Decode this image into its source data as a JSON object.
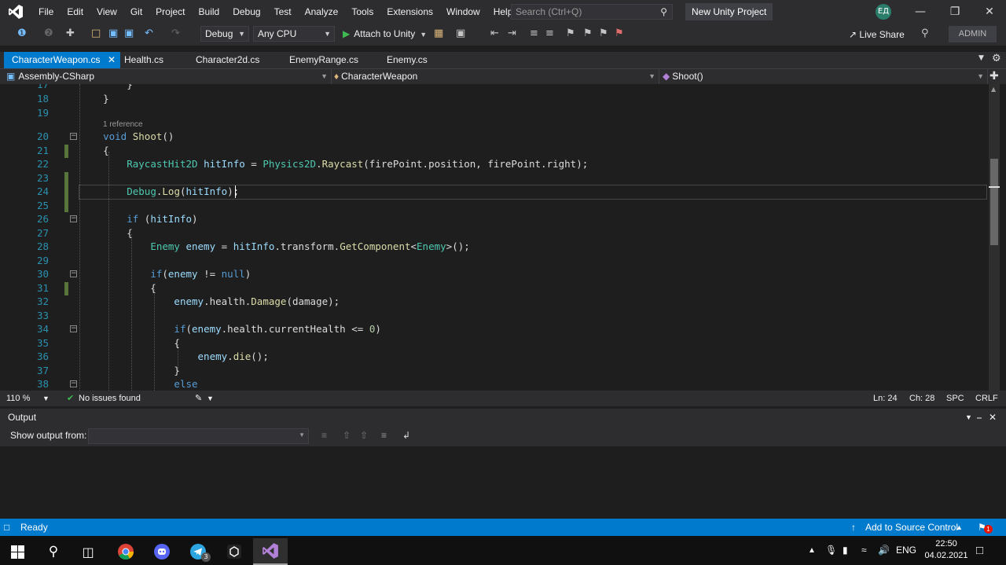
{
  "menubar": {
    "items": [
      "File",
      "Edit",
      "View",
      "Git",
      "Project",
      "Build",
      "Debug",
      "Test",
      "Analyze",
      "Tools",
      "Extensions",
      "Window",
      "Help"
    ],
    "search_placeholder": "Search (Ctrl+Q)",
    "project_name": "New Unity Project",
    "avatar_initials": "ЕД"
  },
  "toolbar": {
    "config": "Debug",
    "platform": "Any CPU",
    "attach_label": "Attach to Unity",
    "live_share": "Live Share",
    "admin_label": "ADMIN"
  },
  "tabs": [
    {
      "label": "CharacterWeapon.cs",
      "active": true
    },
    {
      "label": "Health.cs"
    },
    {
      "label": "Character2d.cs"
    },
    {
      "label": "EnemyRange.cs"
    },
    {
      "label": "Enemy.cs"
    }
  ],
  "navbar": {
    "project": "Assembly-CSharp",
    "class": "CharacterWeapon",
    "member": "Shoot()"
  },
  "editor": {
    "reference_hint": "1 reference",
    "lines": [
      {
        "n": "17",
        "text": "        }"
      },
      {
        "n": "18",
        "text": "    }"
      },
      {
        "n": "19",
        "text": ""
      },
      {
        "n": "20",
        "text": "    void Shoot()"
      },
      {
        "n": "21",
        "text": "    {"
      },
      {
        "n": "22",
        "text": "        RaycastHit2D hitInfo = Physics2D.Raycast(firePoint.position, firePoint.right);"
      },
      {
        "n": "23",
        "text": ""
      },
      {
        "n": "24",
        "text": "        Debug.Log(hitInfo);"
      },
      {
        "n": "25",
        "text": ""
      },
      {
        "n": "26",
        "text": "        if (hitInfo)"
      },
      {
        "n": "27",
        "text": "        {"
      },
      {
        "n": "28",
        "text": "            Enemy enemy = hitInfo.transform.GetComponent<Enemy>();"
      },
      {
        "n": "29",
        "text": ""
      },
      {
        "n": "30",
        "text": "            if(enemy != null)"
      },
      {
        "n": "31",
        "text": "            {"
      },
      {
        "n": "32",
        "text": "                enemy.health.Damage(damage);"
      },
      {
        "n": "33",
        "text": ""
      },
      {
        "n": "34",
        "text": "                if(enemy.health.currentHealth <= 0)"
      },
      {
        "n": "35",
        "text": "                {"
      },
      {
        "n": "36",
        "text": "                    enemy.die();"
      },
      {
        "n": "37",
        "text": "                }"
      },
      {
        "n": "38",
        "text": "                else"
      }
    ]
  },
  "editor_status": {
    "zoom": "110 %",
    "issues": "No issues found",
    "line": "Ln: 24",
    "col": "Ch: 28",
    "spc": "SPC",
    "crlf": "CRLF"
  },
  "output": {
    "title": "Output",
    "show_from_label": "Show output from:"
  },
  "statusbar": {
    "ready": "Ready",
    "source_control": "Add to Source Control",
    "notif_count": "1"
  },
  "taskbar": {
    "lang": "ENG",
    "time": "22:50",
    "date": "04.02.2021",
    "telegram_badge": "3"
  },
  "colors": {
    "accent": "#007acc",
    "keyword": "#569cd6",
    "type": "#4ec9b0",
    "method": "#dcdcaa"
  }
}
